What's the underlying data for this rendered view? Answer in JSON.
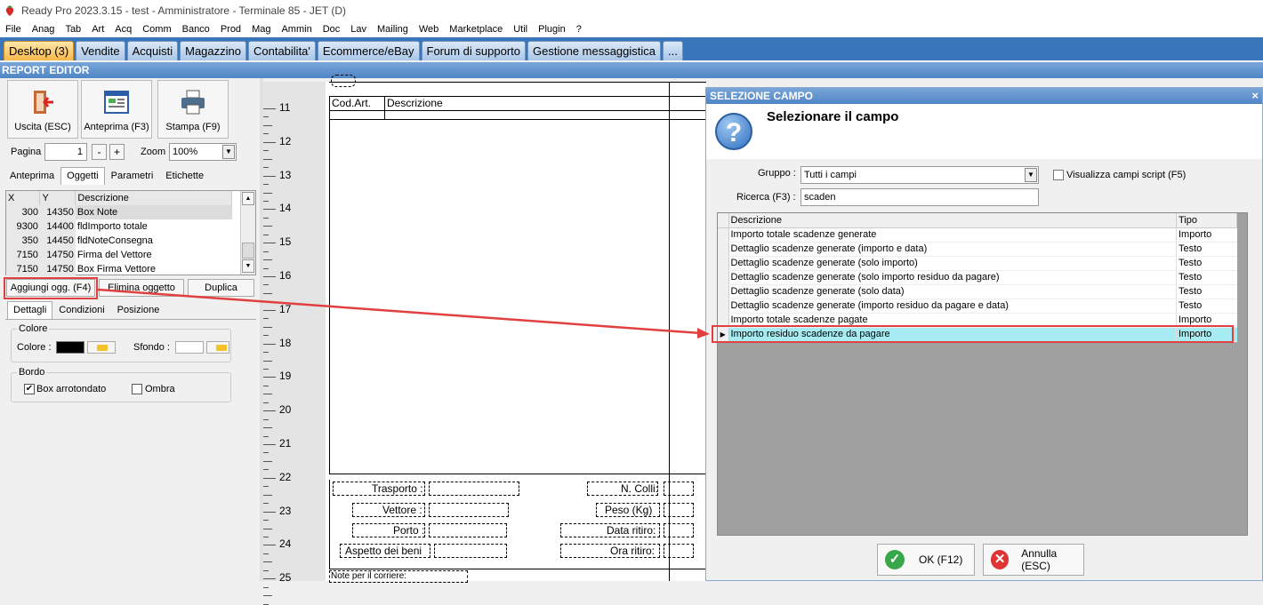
{
  "title": "Ready Pro 2023.3.15 - test - Amministratore - Terminale 85 - JET (D)",
  "menu": [
    "File",
    "Anag",
    "Tab",
    "Art",
    "Acq",
    "Comm",
    "Banco",
    "Prod",
    "Mag",
    "Ammin",
    "Doc",
    "Lav",
    "Mailing",
    "Web",
    "Marketplace",
    "Util",
    "Plugin",
    "?"
  ],
  "tabs": [
    "Desktop (3)",
    "Vendite",
    "Acquisti",
    "Magazzino",
    "Contabilita'",
    "Ecommerce/eBay",
    "Forum di supporto",
    "Gestione messaggistica",
    "..."
  ],
  "report_header": "REPORT EDITOR",
  "toolbar": {
    "exit": "Uscita (ESC)",
    "preview": "Anteprima (F3)",
    "print": "Stampa (F9)"
  },
  "page": {
    "label": "Pagina",
    "value": "1",
    "minus": "-",
    "plus": "+",
    "zoom_label": "Zoom",
    "zoom_value": "100%"
  },
  "main_tabs": [
    "Anteprima",
    "Oggetti",
    "Parametri",
    "Etichette"
  ],
  "objects": {
    "headers": [
      "X",
      "Y",
      "Descrizione"
    ],
    "rows": [
      [
        "300",
        "14350",
        "Box Note"
      ],
      [
        "9300",
        "14400",
        "fldImporto totale"
      ],
      [
        "350",
        "14450",
        "fldNoteConsegna"
      ],
      [
        "7150",
        "14750",
        "Firma del Vettore"
      ],
      [
        "7150",
        "14750",
        "Box Firma Vettore"
      ]
    ]
  },
  "object_buttons": {
    "add": "Aggiungi ogg. (F4)",
    "delete": "Elimina oggetto",
    "duplicate": "Duplica"
  },
  "detail_tabs": [
    "Dettagli",
    "Condizioni",
    "Posizione"
  ],
  "color_group": {
    "title": "Colore",
    "color_label": "Colore :",
    "background_label": "Sfondo :",
    "color_value": "#000000"
  },
  "border_group": {
    "title": "Bordo",
    "rounded_label": "Box arrotondato",
    "rounded_checked": true,
    "shadow_label": "Ombra",
    "shadow_checked": false
  },
  "ruler": [
    "11",
    "12",
    "13",
    "14",
    "15",
    "16",
    "17",
    "18",
    "19",
    "20",
    "21",
    "22",
    "23",
    "24",
    "25"
  ],
  "report": {
    "col_code": "Cod.Art.",
    "col_desc": "Descrizione",
    "trasporto": "Trasporto :",
    "vettore": "Vettore :",
    "porto": "Porto :",
    "aspetto": "Aspetto dei beni",
    "colli": "N. Colli:",
    "peso": "Peso (Kg)",
    "data_ritiro": "Data ritiro:",
    "ora_ritiro": "Ora ritiro:",
    "note": "Note per il corriere:"
  },
  "dialog": {
    "title": "SELEZIONE CAMPO",
    "close": "×",
    "heading": "Selezionare il campo",
    "group_label": "Gruppo :",
    "group_value": "Tutti i campi",
    "script_label": "Visualizza campi script (F5)",
    "search_label": "Ricerca (F3) :",
    "search_value": "scaden",
    "headers": [
      "Descrizione",
      "Tipo"
    ],
    "rows": [
      [
        "Importo totale scadenze generate",
        "Importo"
      ],
      [
        "Dettaglio scadenze generate (importo e data)",
        "Testo"
      ],
      [
        "Dettaglio scadenze generate (solo importo)",
        "Testo"
      ],
      [
        "Dettaglio scadenze generate (solo importo residuo da pagare)",
        "Testo"
      ],
      [
        "Dettaglio scadenze generate (solo data)",
        "Testo"
      ],
      [
        "Dettaglio scadenze generate (importo residuo da pagare e data)",
        "Testo"
      ],
      [
        "Importo totale scadenze pagate",
        "Importo"
      ],
      [
        "Importo residuo scadenze da pagare",
        "Importo"
      ]
    ],
    "selected_index": 7,
    "ok": "OK (F12)",
    "cancel": "Annulla (ESC)"
  }
}
